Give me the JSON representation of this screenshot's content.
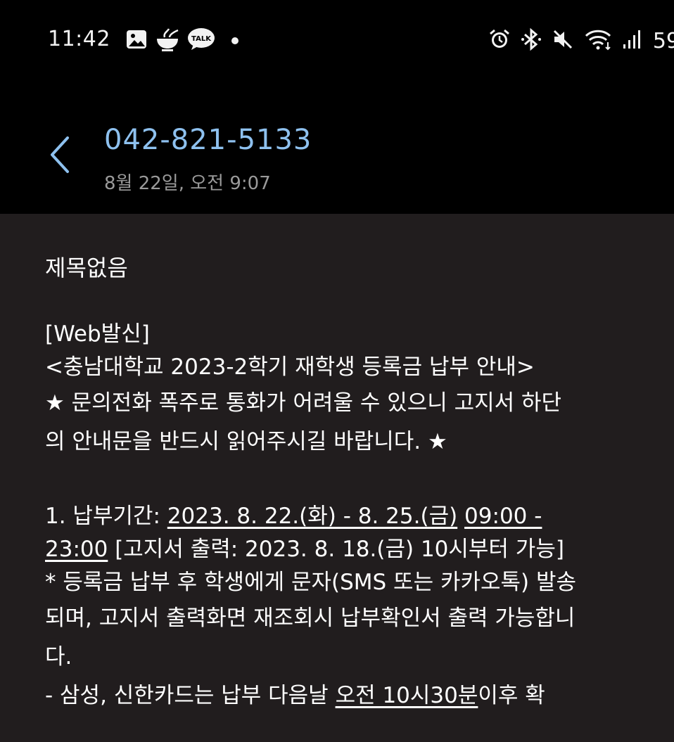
{
  "status_bar": {
    "time": "11:42",
    "battery": "59",
    "left_icons": [
      "gallery-icon",
      "food-bowl-icon",
      "kakaotalk-icon",
      "notification-dot-icon"
    ],
    "right_icons": [
      "alarm-icon",
      "bluetooth-icon",
      "mute-icon",
      "wifi-icon",
      "signal-icon"
    ],
    "kakaotalk_badge": "TALK"
  },
  "header": {
    "sender": "042-821-5133",
    "date": "8월 22일, 오전 9:07",
    "accent_color": "#8ec1ef"
  },
  "message": {
    "subject": "제목없음",
    "lines": {
      "l1": "[Web발신]",
      "l2": "<충남대학교 2023-2학기 재학생 등록금 납부 안내>",
      "l3": "★ 문의전화 폭주로 통화가 어려울 수 있으니 고지서 하단",
      "l4": "의 안내문을 반드시 읽어주시길 바랍니다. ★",
      "l6_a": "1. 납부기간: ",
      "l6_b": "2023. 8. 22.(화) - 8. 25.(금)",
      "l6_c": " ",
      "l6_d": "09:00 -",
      "l7_a": "23:00",
      "l7_b": " [고지서 출력: 2023. 8. 18.(금) 10시부터 가능]",
      "l8": " * 등록금 납부 후 학생에게 문자(SMS 또는 카카오톡) 발송",
      "l9": "되며, 고지서 출력화면 재조회시 납부확인서 출력 가능합니",
      "l10": "다.",
      "l11_a": "  - 삼성, 신한카드는 납부 다음날 ",
      "l11_b": "오전 10시30분",
      "l11_c": "이후 확"
    }
  }
}
